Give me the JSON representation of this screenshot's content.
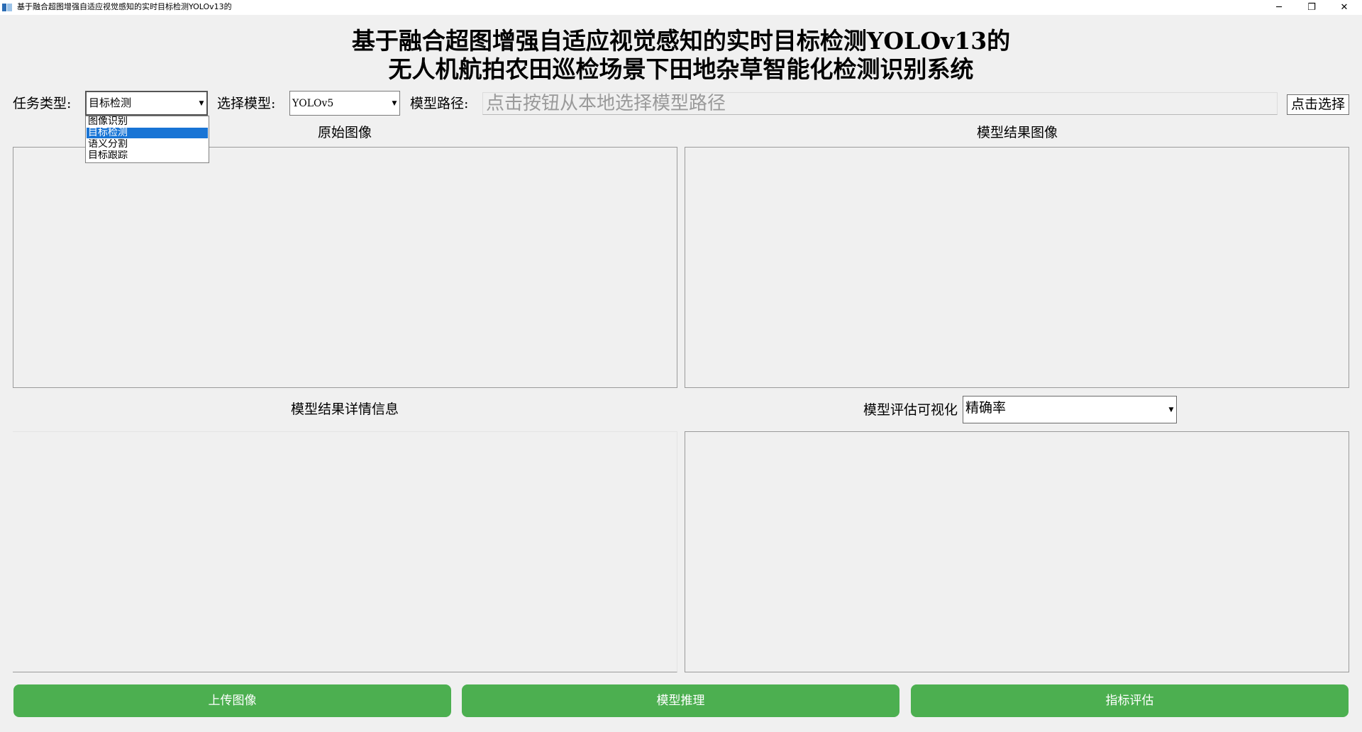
{
  "window": {
    "title": "基于融合超图增强自适应视觉感知的实时目标检测YOLOv13的",
    "minimize": "─",
    "maximize": "❐",
    "close": "✕"
  },
  "header": {
    "line1": "基于融合超图增强自适应视觉感知的实时目标检测YOLOv13的",
    "line2": "无人机航拍农田巡检场景下田地杂草智能化检测识别系统"
  },
  "controls": {
    "task_label": "任务类型:",
    "task_value": "目标检测",
    "task_options": [
      {
        "label": "图像识别",
        "selected": false
      },
      {
        "label": "目标检测",
        "selected": true
      },
      {
        "label": "语义分割",
        "selected": false
      },
      {
        "label": "目标跟踪",
        "selected": false
      }
    ],
    "model_label": "选择模型:",
    "model_value": "YOLOv5",
    "path_label": "模型路径:",
    "path_placeholder": "点击按钮从本地选择模型路径",
    "select_button": "点击选择"
  },
  "sections": {
    "original_image": "原始图像",
    "result_image": "模型结果图像",
    "result_details": "模型结果详情信息",
    "eval_label": "模型评估可视化",
    "eval_metric": "精确率"
  },
  "buttons": {
    "upload": "上传图像",
    "infer": "模型推理",
    "evaluate": "指标评估"
  },
  "icons": {
    "dropdown_arrow": "▼",
    "app_icon": "app-window-icon"
  },
  "colors": {
    "accent_green": "#4caf50",
    "selection_blue": "#1874d5",
    "background": "#f0f0f0"
  }
}
